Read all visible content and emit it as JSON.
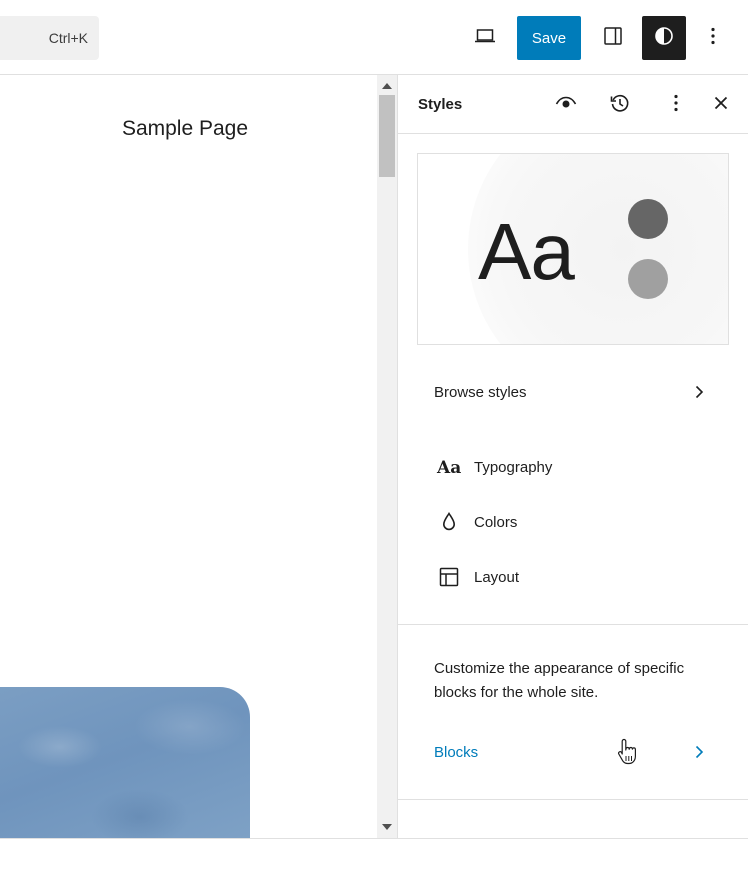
{
  "toolbar": {
    "command_shortcut": "Ctrl+K",
    "save_label": "Save"
  },
  "canvas": {
    "page_title": "Sample Page"
  },
  "sidebar": {
    "title": "Styles",
    "preview": {
      "sample_text": "Aa",
      "colors": [
        "#666666",
        "#a0a0a0"
      ]
    },
    "browse_styles": "Browse styles",
    "items": [
      {
        "label": "Typography",
        "icon": "typography-icon"
      },
      {
        "label": "Colors",
        "icon": "droplet-icon"
      },
      {
        "label": "Layout",
        "icon": "layout-icon"
      }
    ],
    "blocks_description": "Customize the appearance of specific blocks for the whole site.",
    "blocks_link": "Blocks"
  },
  "colors": {
    "accent": "#007cba",
    "dark": "#1e1e1e"
  }
}
